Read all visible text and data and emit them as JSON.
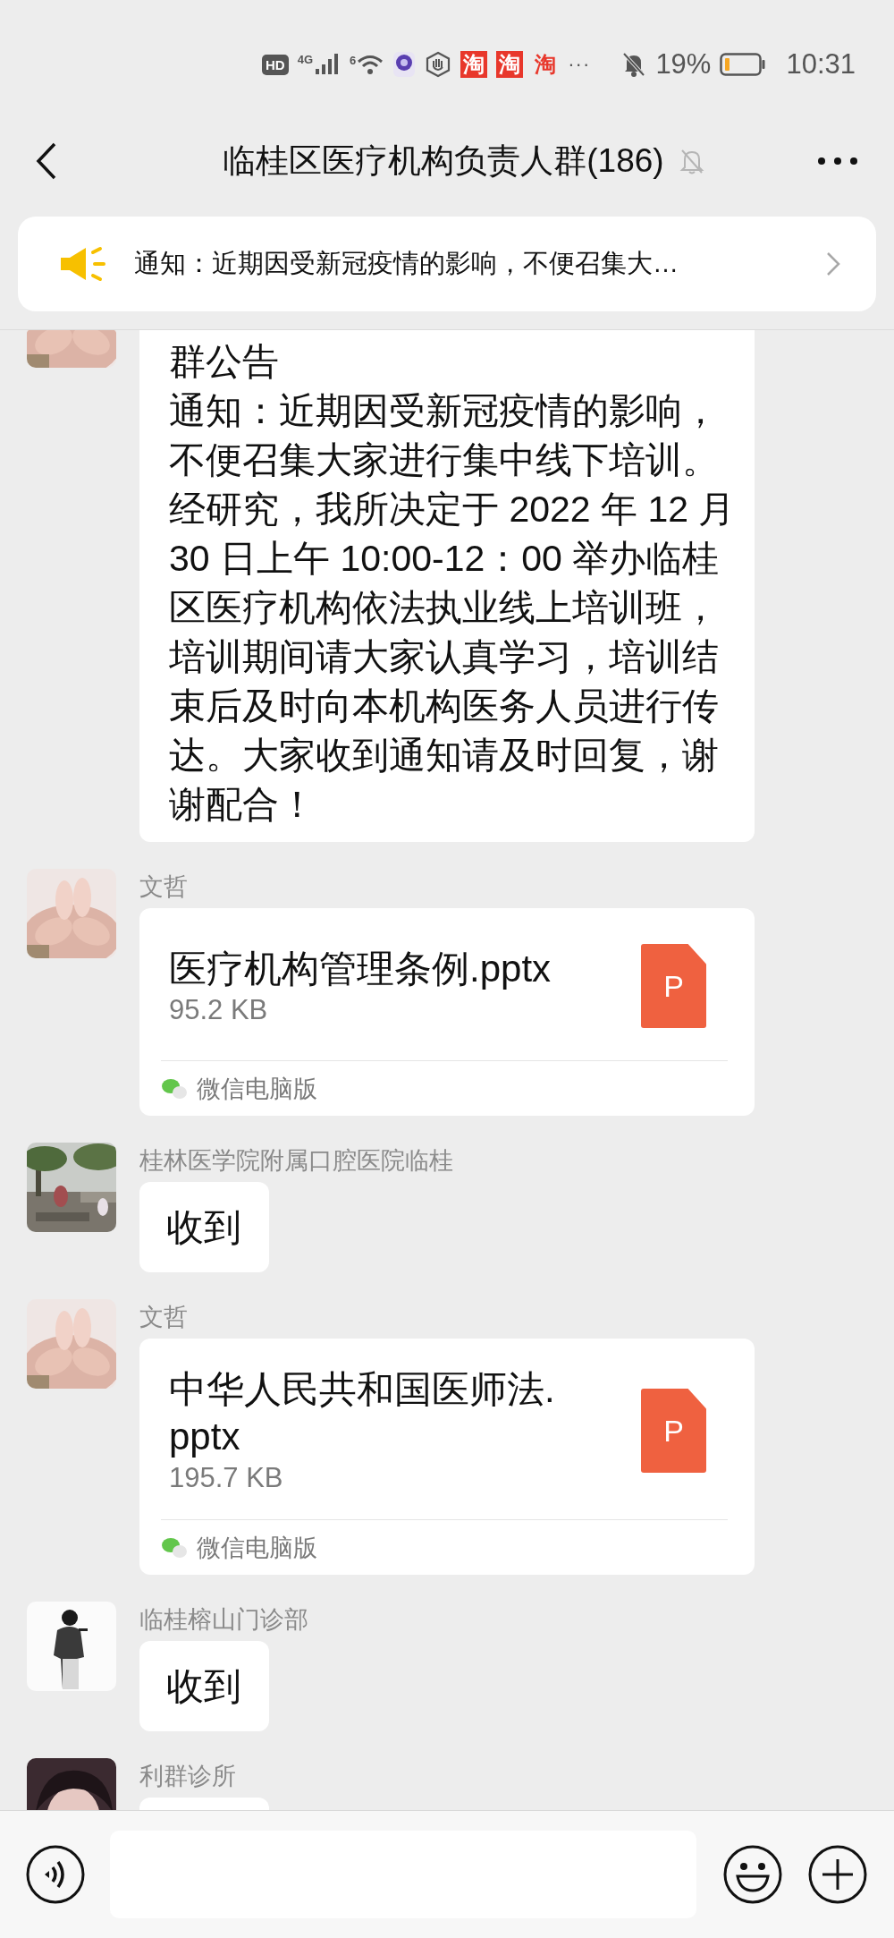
{
  "status_bar": {
    "hd": "HD",
    "network": "4G",
    "wifi": "6",
    "app_notifications": [
      "淘",
      "淘",
      "淘"
    ],
    "more": "···",
    "battery": "19%",
    "time": "10:31"
  },
  "header": {
    "title": "临桂区医疗机构负责人群(186)",
    "muted": true
  },
  "pinned_notice": {
    "text": "通知：近期因受新冠疫情的影响，不便召集大…"
  },
  "messages": [
    {
      "kind": "announcement",
      "title": "群公告",
      "text": "通知：近期因受新冠疫情的影响，不便召集大家进行集中线下培训。经研究，我所决定于 2022 年 12 月 30 日上午 10:00-12：00 举办临桂区医疗机构依法执业线上培训班，培训期间请大家认真学习，培训结束后及时向本机构医务人员进行传达。大家收到通知请及时回复，谢谢配合！"
    },
    {
      "kind": "file",
      "sender": "文哲",
      "filename": "医疗机构管理条例.pptx",
      "size": "95.2 KB",
      "file_icon": "P",
      "source": "微信电脑版"
    },
    {
      "kind": "text",
      "sender": "桂林医学院附属口腔医院临桂",
      "text": "收到"
    },
    {
      "kind": "file",
      "sender": "文哲",
      "filename": "中华人民共和国医师法.pptx",
      "size": "195.7 KB",
      "file_icon": "P",
      "source": "微信电脑版"
    },
    {
      "kind": "text",
      "sender": "临桂榕山门诊部",
      "text": "收到"
    },
    {
      "kind": "text",
      "sender": "利群诊所"
    }
  ]
}
